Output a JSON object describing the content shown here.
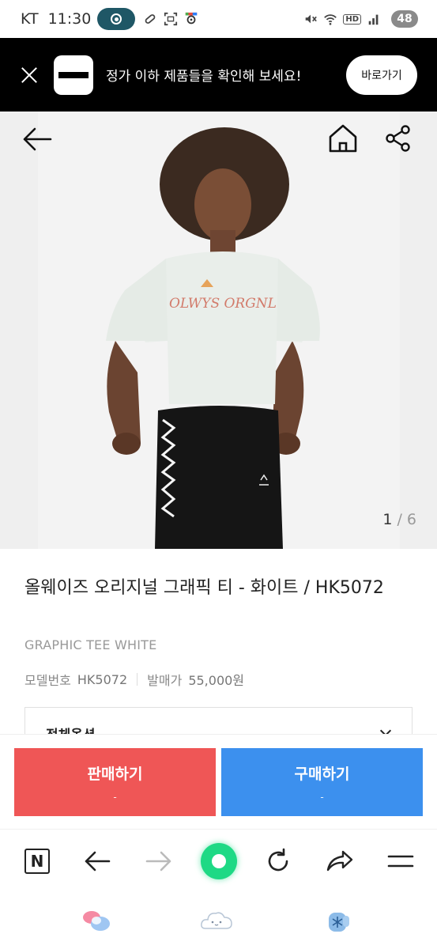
{
  "status_bar": {
    "carrier": "KT",
    "time": "11:30",
    "hd_label": "HD",
    "battery": "48"
  },
  "banner": {
    "message": "정가 이하 제품들을 확인해 보세요!",
    "button_label": "바로가기"
  },
  "gallery": {
    "current": "1",
    "separator": "/",
    "total": "6"
  },
  "product": {
    "title": "올웨이즈 오리지널 그래픽 티 - 화이트 / HK5072",
    "subtitle": "GRAPHIC TEE WHITE",
    "model_label": "모델번호",
    "model_value": "HK5072",
    "price_label": "발매가",
    "price_value": "55,000원",
    "options_label": "전체옵션"
  },
  "actions": {
    "sell_label": "판매하기",
    "sell_sub": "-",
    "buy_label": "구매하기",
    "buy_sub": "-"
  },
  "browser_bar": {
    "n_label": "N"
  },
  "colors": {
    "sell": "#ef5656",
    "buy": "#3c90ee",
    "green": "#1ed985",
    "banner_bg": "#000000"
  }
}
